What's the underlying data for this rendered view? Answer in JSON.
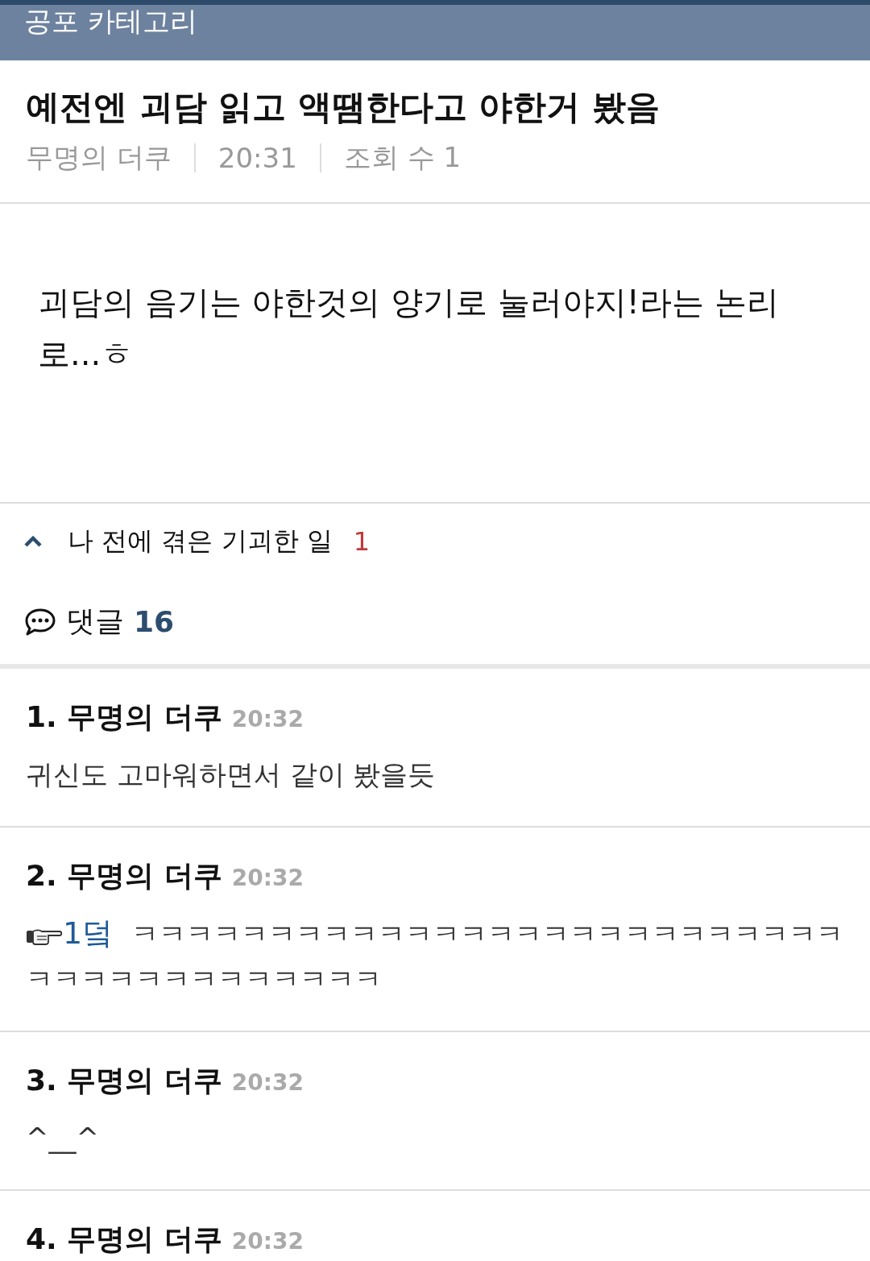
{
  "header": {
    "title": "공포 카테고리"
  },
  "post": {
    "title": "예전엔 괴담 읽고 액땜한다고 야한거 봤음",
    "author": "무명의 더쿠",
    "time": "20:31",
    "views": "조회 수 1",
    "body": "괴담의 음기는 야한것의 양기로 눌러야지!라는 논리로...ㅎ"
  },
  "category": {
    "name": "나 전에 겪은 기괴한 일",
    "count": "1",
    "expanded": true
  },
  "comments_header": {
    "label": "댓글",
    "count": "16"
  },
  "comments": [
    {
      "number": "1.",
      "author": "무명의 더쿠",
      "time": "20:32",
      "text": "귀신도 고마워하면서 같이 봤을듯"
    },
    {
      "number": "2.",
      "author": "무명의 더쿠",
      "time": "20:32",
      "reply_to": "1덬",
      "text": "ㅋㅋㅋㅋㅋㅋㅋㅋㅋㅋㅋㅋㅋㅋㅋㅋㅋㅋㅋㅋㅋㅋㅋㅋㅋㅋㅋㅋㅋㅋㅋㅋㅋㅋㅋㅋㅋㅋㅋ"
    },
    {
      "number": "3.",
      "author": "무명의 더쿠",
      "time": "20:32",
      "text": "^__^"
    },
    {
      "number": "4.",
      "author": "무명의 더쿠",
      "time": "20:32"
    }
  ]
}
